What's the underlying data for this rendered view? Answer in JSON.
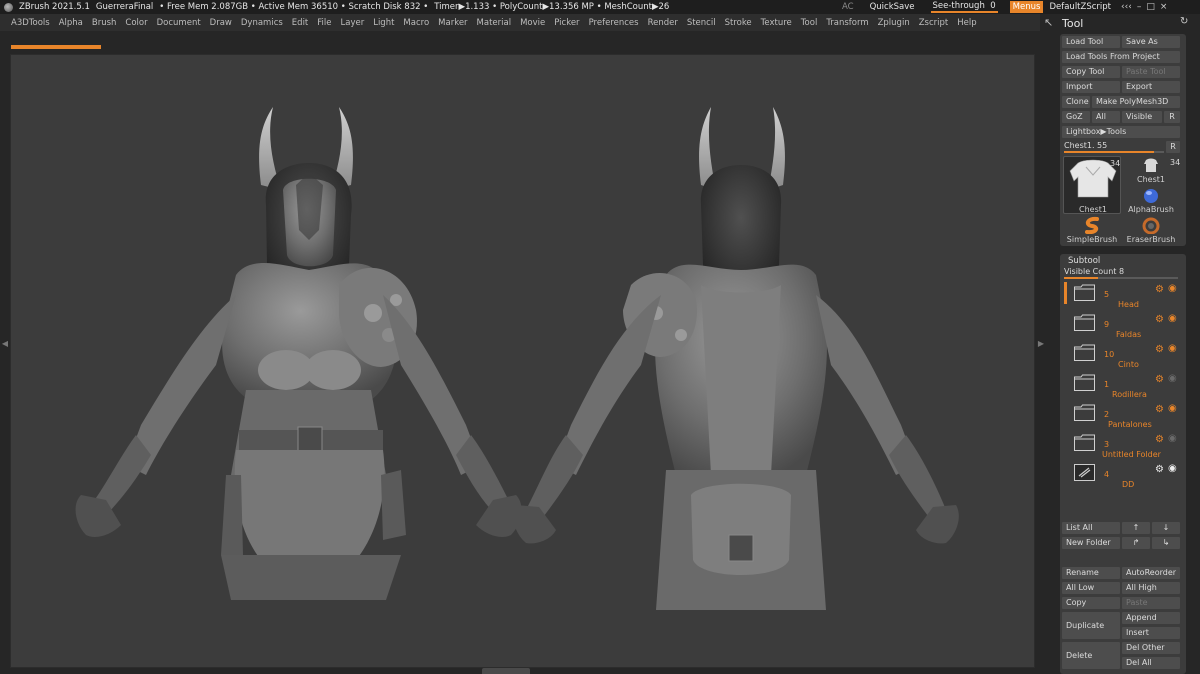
{
  "titlebar": {
    "left_items": [
      "ZBrush 2021.5.1",
      "GuerreraFinal",
      "• Free Mem 2.087GB • Active Mem 36510 • Scratch Disk 832 •",
      "Timer▶1.133 • PolyCount▶13.356 MP • MeshCount▶26"
    ],
    "ac": "AC",
    "quicksave": "QuickSave",
    "see_through_label": "See-through",
    "see_through_value": "0",
    "menus": "Menus",
    "script": "DefaultZScript",
    "win_controls": [
      "‹‹‹",
      "–",
      "□",
      "×"
    ]
  },
  "menubar": {
    "items": [
      "A3DTools",
      "Alpha",
      "Brush",
      "Color",
      "Document",
      "Draw",
      "Dynamics",
      "Edit",
      "File",
      "Layer",
      "Light",
      "Macro",
      "Marker",
      "Material",
      "Movie",
      "Picker",
      "Preferences",
      "Render",
      "Stencil",
      "Stroke",
      "Texture",
      "Tool",
      "Transform",
      "Zplugin",
      "Zscript",
      "Help"
    ]
  },
  "progress": {
    "fraction": 1.0
  },
  "tray": {
    "title": "Tool"
  },
  "tool": {
    "load_tool": "Load Tool",
    "save_as": "Save As",
    "load_tools_from_project": "Load Tools From Project",
    "copy_tool": "Copy Tool",
    "paste_tool": "Paste Tool",
    "import": "Import",
    "export": "Export",
    "clone": "Clone",
    "make_polymesh": "Make PolyMesh3D",
    "goz": "GoZ",
    "all": "All",
    "visible": "Visible",
    "r": "R",
    "lightbox_tools": "Lightbox▶Tools",
    "slider_label": "Chest1. 55",
    "slider_fraction": 0.9,
    "slider_r": "R",
    "thumb_main_label": "Chest1",
    "thumb_main_count": "34",
    "thumb_small_count": "34",
    "thumbs": [
      "Chest1",
      "AlphaBrush",
      "SimpleBrush",
      "EraserBrush"
    ]
  },
  "subtool": {
    "title": "Subtool",
    "visible_count": "Visible Count 8",
    "visible_count_fraction": 0.3,
    "rows": [
      {
        "num": "5",
        "name": "Head",
        "eye": "on",
        "selected": true
      },
      {
        "num": "9",
        "name": "Faldas",
        "eye": "on",
        "selected": false
      },
      {
        "num": "10",
        "name": "Cinto",
        "eye": "on",
        "selected": false
      },
      {
        "num": "1",
        "name": "Rodillera",
        "eye": "off",
        "selected": false
      },
      {
        "num": "2",
        "name": "Pantalones",
        "eye": "on",
        "selected": false
      },
      {
        "num": "3",
        "name": "Untitled Folder",
        "eye": "off",
        "selected": false
      },
      {
        "num": "4",
        "name": "DD",
        "eye": "white",
        "selected": false
      }
    ],
    "list_all": "List All",
    "new_folder": "New Folder",
    "rename": "Rename",
    "autoreorder": "AutoReorder",
    "all_low": "All Low",
    "all_high": "All High",
    "copy": "Copy",
    "paste": "Paste",
    "append": "Append",
    "duplicate": "Duplicate",
    "insert": "Insert",
    "delete": "Delete",
    "del_other": "Del Other",
    "del_all": "Del All"
  },
  "colors": {
    "accent": "#e8852a",
    "canvas_bg": "#3c3c3c",
    "ui_bg": "#262626",
    "button": "#4d4d4d"
  }
}
